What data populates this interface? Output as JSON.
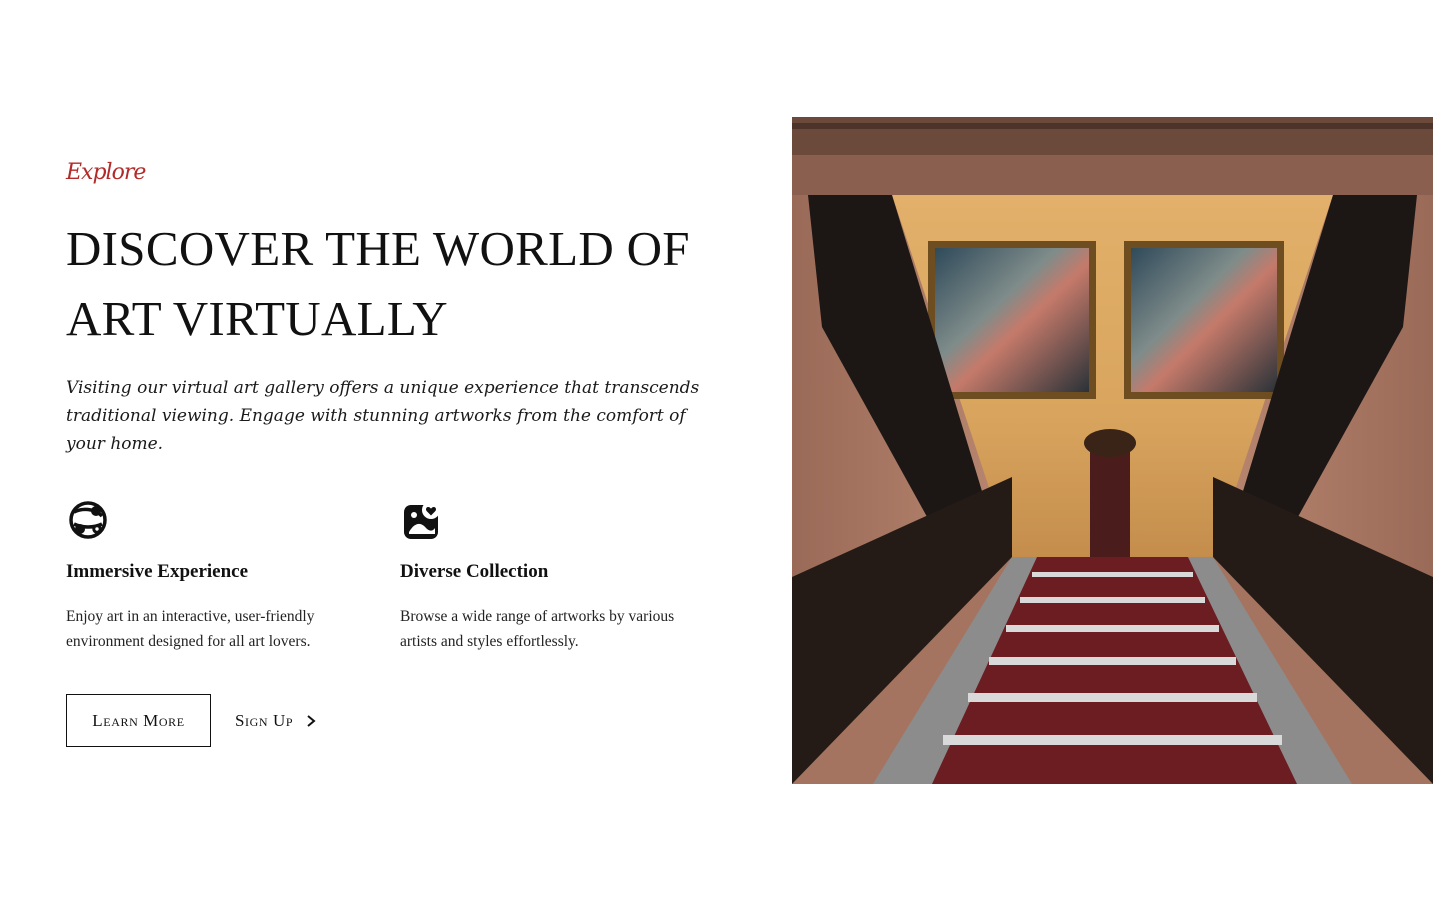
{
  "hero": {
    "tagline": "Explore",
    "headline": "Discover the World of Art Virtually",
    "intro": "Visiting our virtual art gallery offers a unique experience that transcends traditional viewing. Engage with stunning artworks from the comfort of your home."
  },
  "features": [
    {
      "icon": "immersive-icon",
      "title": "Immersive Experience",
      "description": "Enjoy art in an interactive, user-friendly environment designed for all art lovers."
    },
    {
      "icon": "image-heart-icon",
      "title": "Diverse Collection",
      "description": "Browse a wide range of artworks by various artists and styles effortlessly."
    }
  ],
  "actions": {
    "learn_more": "Learn More",
    "sign_up": "Sign Up"
  },
  "colors": {
    "accent": "#b22a2a",
    "text": "#111111",
    "background": "#ffffff"
  }
}
